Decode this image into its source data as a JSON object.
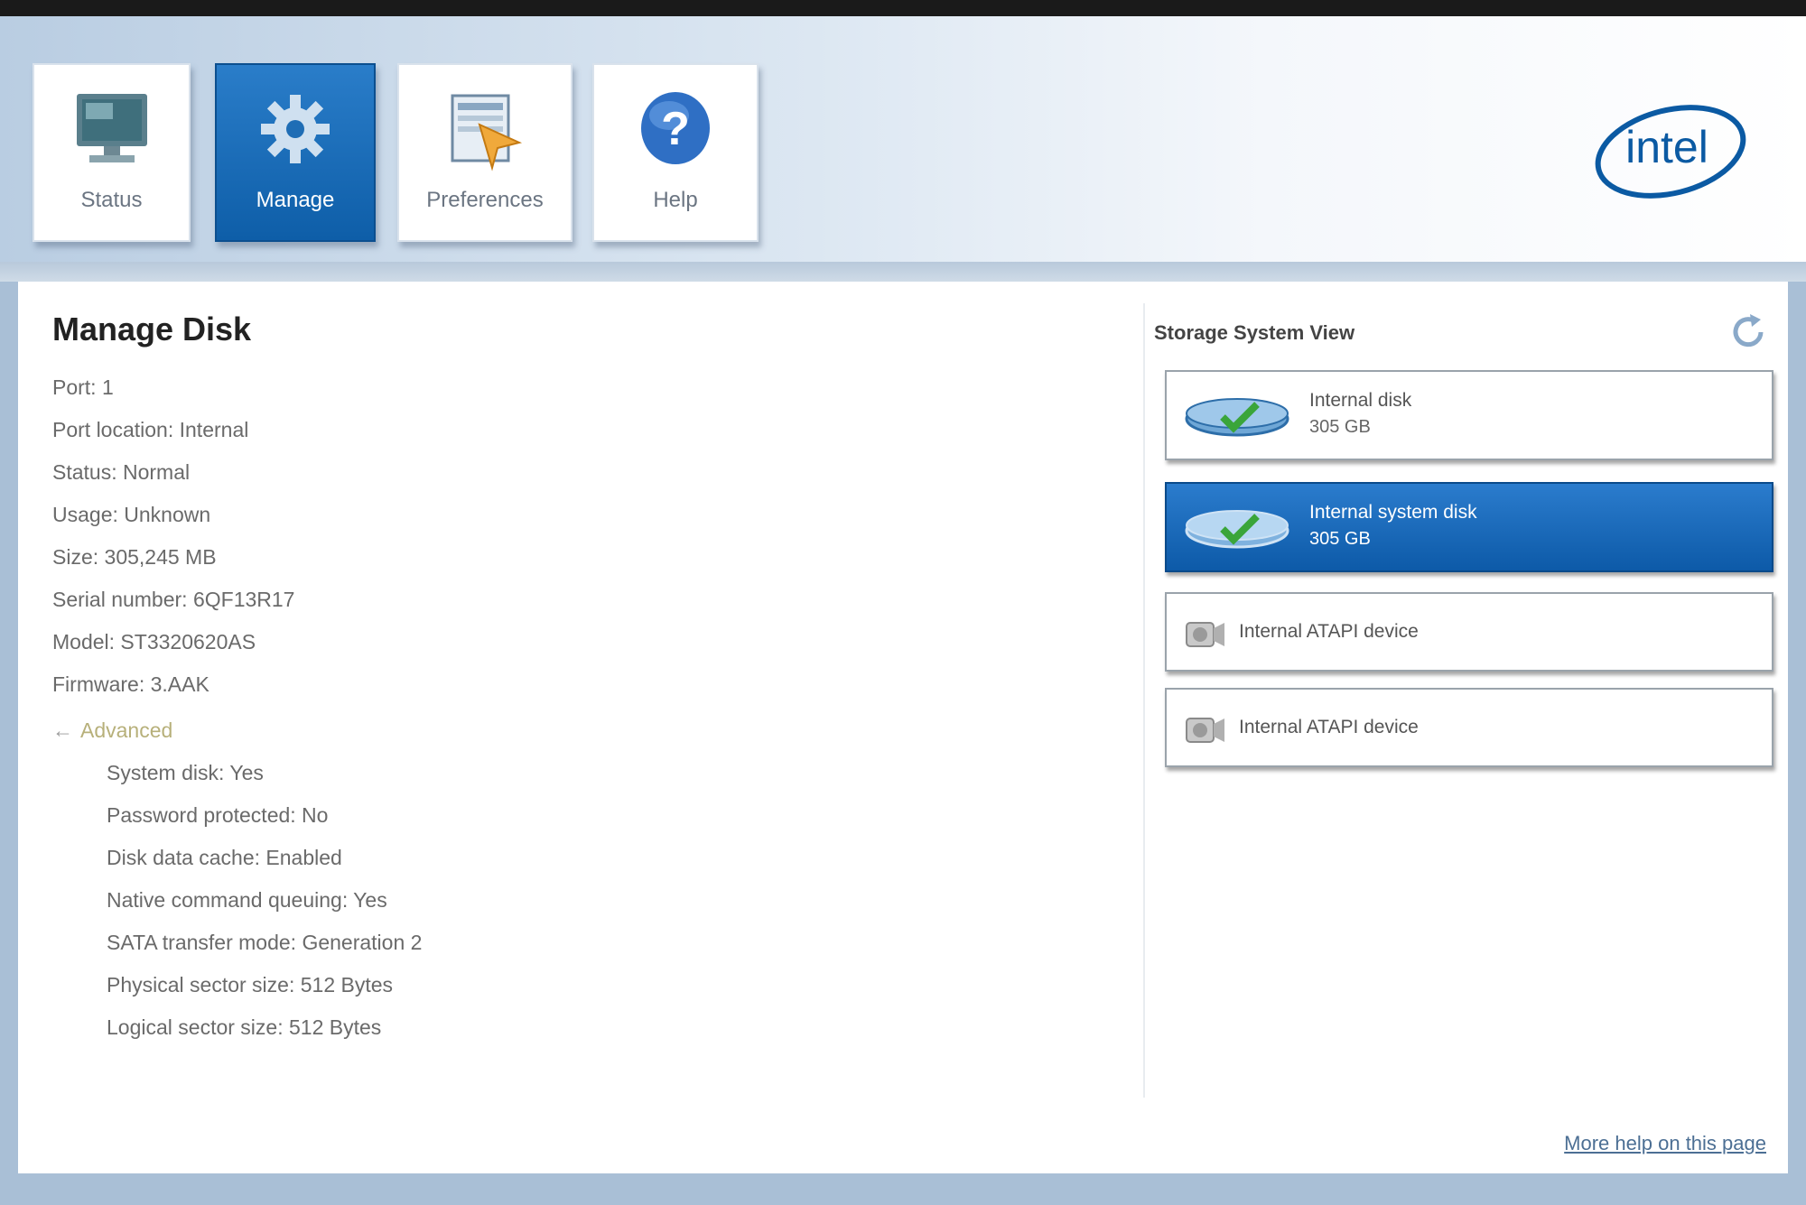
{
  "tabs": [
    {
      "label": "Status",
      "icon": "monitor-icon"
    },
    {
      "label": "Manage",
      "icon": "gear-icon",
      "selected": true
    },
    {
      "label": "Preferences",
      "icon": "preferences-icon"
    },
    {
      "label": "Help",
      "icon": "help-icon"
    }
  ],
  "brand": {
    "logo_text": "intel"
  },
  "main": {
    "title": "Manage Disk",
    "properties": [
      "Port: 1",
      "Port location: Internal",
      "Status: Normal",
      "Usage: Unknown",
      "Size: 305,245 MB",
      "Serial number: 6QF13R17",
      "Model: ST3320620AS",
      "Firmware: 3.AAK"
    ],
    "advanced_label": "Advanced",
    "advanced": [
      "System disk: Yes",
      "Password protected: No",
      "Disk data cache: Enabled",
      "Native command queuing: Yes",
      "SATA transfer mode: Generation 2",
      "Physical sector size: 512 Bytes",
      "Logical sector size: 512 Bytes"
    ]
  },
  "storage_view": {
    "title": "Storage System View",
    "devices": [
      {
        "name": "Internal disk",
        "size": "305 GB",
        "icon": "disk-icon"
      },
      {
        "name": "Internal system disk",
        "size": "305 GB",
        "icon": "disk-icon",
        "selected": true
      },
      {
        "name": "Internal ATAPI device",
        "icon": "optical-drive-icon"
      },
      {
        "name": "Internal ATAPI device",
        "icon": "optical-drive-icon"
      }
    ]
  },
  "footer": {
    "help_link": "More help on this page"
  },
  "colors": {
    "accent": "#0e5ea8",
    "brand": "#0b5aa3"
  }
}
